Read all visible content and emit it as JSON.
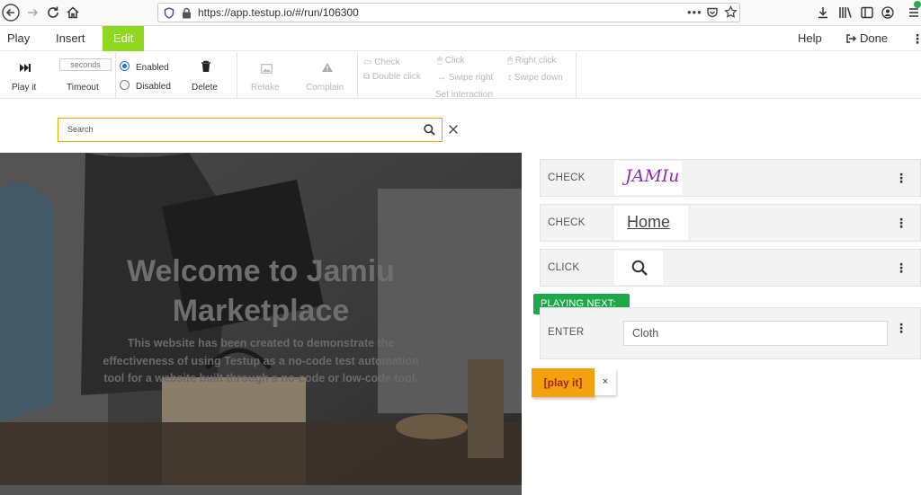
{
  "browser": {
    "url": "https://app.testup.io/#/run/106300"
  },
  "menu": {
    "play": "Play",
    "insert": "Insert",
    "edit": "Edit",
    "help": "Help",
    "done": "Done"
  },
  "toolbar": {
    "play_it": "Play it",
    "timeout_placeholder": "seconds",
    "timeout": "Timeout",
    "enabled": "Enabled",
    "disabled": "Disabled",
    "enabled_selected": true,
    "delete": "Delete",
    "retake": "Retake",
    "complain": "Complain",
    "check": "Check",
    "double_click": "Double click",
    "click": "Click",
    "swipe_right": "Swipe right",
    "right_click": "Right click",
    "swipe_down": "Swipe down",
    "set_interaction": "Set interaction"
  },
  "search": {
    "placeholder": "Search"
  },
  "hero": {
    "title_line1": "Welcome to Jamiu",
    "title_line2": "Marketplace",
    "desc_line1": "This website has been created to demonstrate the",
    "desc_line2": "effectiveness of using Testup as a no-code test automation",
    "desc_line3": "tool for a website built through a no-code or low-code tool."
  },
  "steps": [
    {
      "action": "CHECK",
      "thumb_text": "JAMIu"
    },
    {
      "action": "CHECK",
      "thumb_text": "Home"
    },
    {
      "action": "CLICK",
      "thumb_icon": "search-icon"
    },
    {
      "action": "ENTER",
      "value": "Cloth"
    }
  ],
  "playing_next": "PLAYING NEXT:",
  "play_it_button": "[play it]",
  "close_label": "×",
  "colors": {
    "edit_tab": "#8fd81e",
    "playing_next": "#1ea84a",
    "play_it": "#f5a00e",
    "search_border": "#f0a500"
  }
}
